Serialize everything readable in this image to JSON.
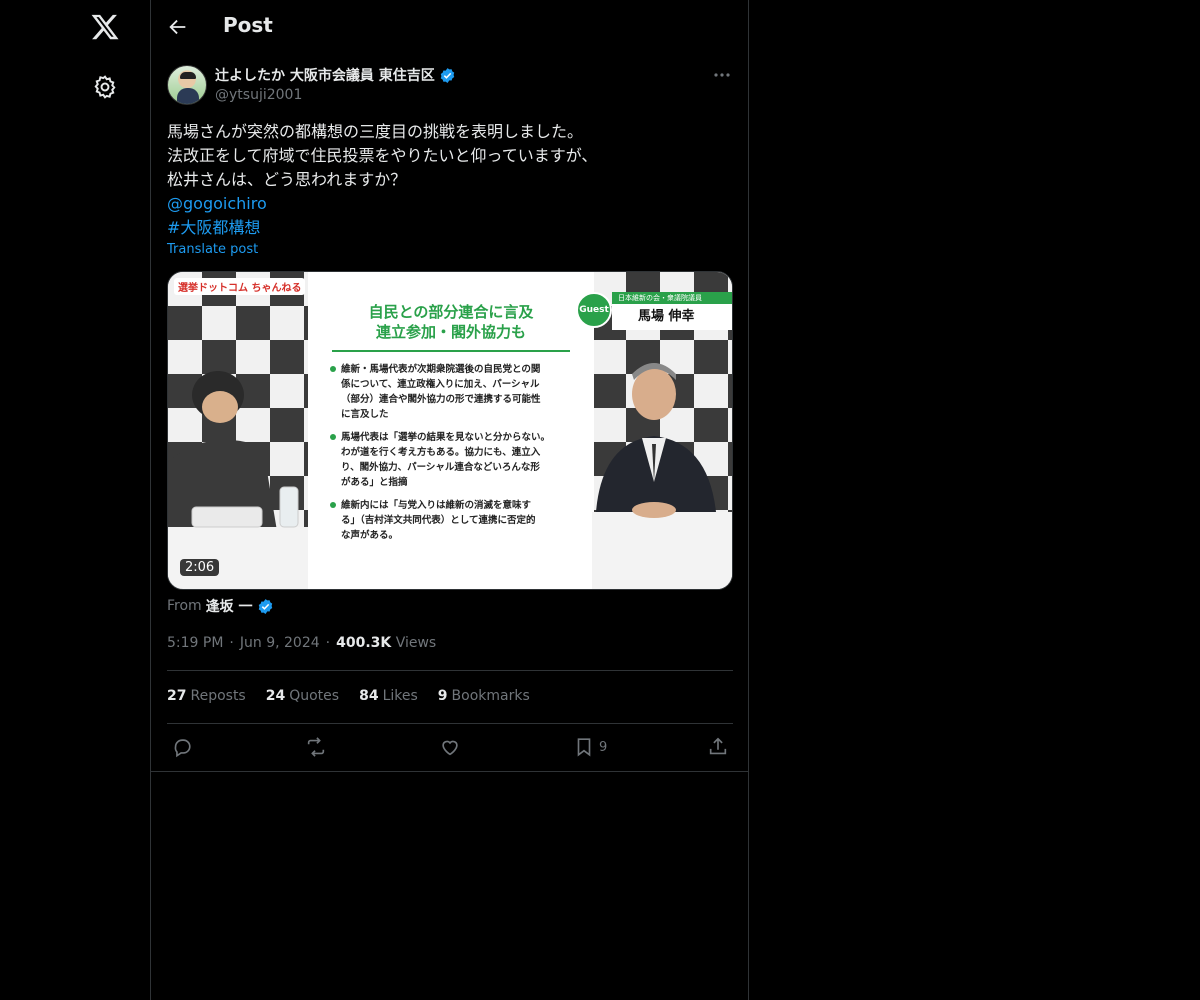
{
  "header": {
    "title": "Post"
  },
  "author": {
    "display_name": "辻よしたか 大阪市会議員 東住吉区",
    "handle": "@ytsuji2001",
    "verified": true
  },
  "post": {
    "lines": [
      "馬場さんが突然の都構想の三度目の挑戦を表明しました。",
      "法改正をして府域で住民投票をやりたいと仰っていますが、",
      "松井さんは、どう思われますか？"
    ],
    "mention": "@gogoichiro",
    "hashtag": "#大阪都構想",
    "translate_label": "Translate post"
  },
  "media": {
    "brand_label": "選挙ドットコム ちゃんねる",
    "slide_title_1": "自民との部分連合に言及",
    "slide_title_2": "連立参加・閣外協力も",
    "slide_bullets": [
      "維新・馬場代表が次期衆院選後の自民党との関\n係について、連立政権入りに加え、パーシャル\n（部分）連合や閣外協力の形で連携する可能性\nに言及した",
      "馬場代表は「選挙の結果を見ないと分からない。\nわが道を行く考え方もある。協力にも、連立入\nり、閣外協力、パーシャル連合などいろんな形\nがある」と指摘",
      "維新内には「与党入りは維新の消滅を意味す\nる」（吉村洋文共同代表）として連携に否定的\nな声がある。"
    ],
    "guest_badge": "Guest",
    "guest_affiliation": "日本維新の会・衆議院議員",
    "guest_name": "馬場 伸幸",
    "duration": "2:06"
  },
  "source": {
    "from_label": "From",
    "name": "逢坂 一",
    "verified": true
  },
  "meta": {
    "time": "5:19 PM",
    "date": "Jun 9, 2024",
    "views_count": "400.3K",
    "views_label": "Views"
  },
  "stats": {
    "reposts_count": "27",
    "reposts_label": "Reposts",
    "quotes_count": "24",
    "quotes_label": "Quotes",
    "likes_count": "84",
    "likes_label": "Likes",
    "bookmarks_count": "9",
    "bookmarks_label": "Bookmarks"
  },
  "actions": {
    "bookmark_count": "9"
  },
  "colors": {
    "accent": "#1d9bf0",
    "muted": "#71767b",
    "text": "#e7e9ea",
    "border": "#2f3336",
    "slide_green": "#2aa14a"
  },
  "icons": [
    "x-logo-icon",
    "gear-icon",
    "arrow-left-icon",
    "verified-badge-icon",
    "more-horizontal-icon",
    "reply-icon",
    "repost-icon",
    "like-icon",
    "bookmark-icon",
    "share-icon"
  ]
}
